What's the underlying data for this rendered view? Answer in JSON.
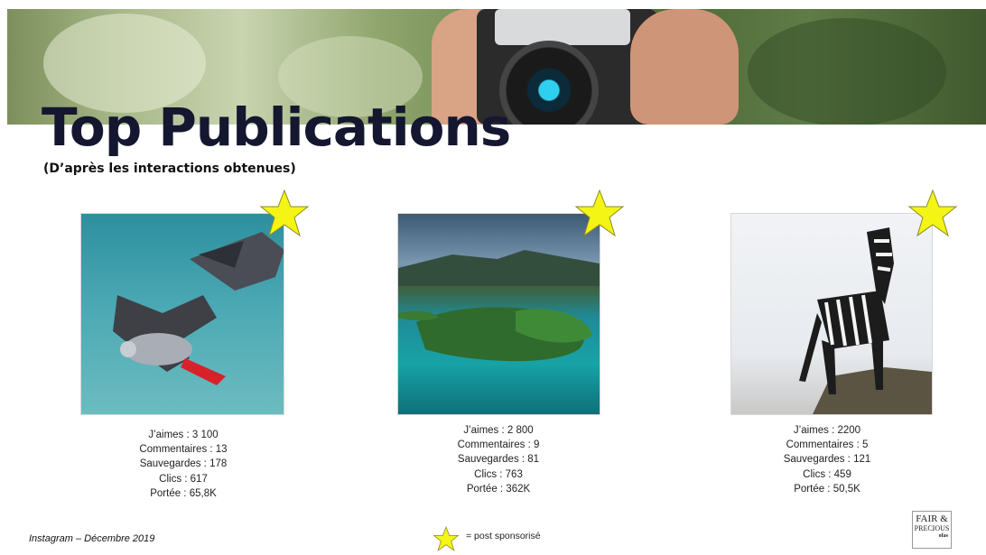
{
  "header": {
    "title": "Top Publications",
    "subtitle": "(D’après les interactions obtenues)"
  },
  "posts": [
    {
      "image": "grey-parrots-flying",
      "sponsored": true,
      "stats": [
        "J’aimes : 3 100",
        "Commentaires : 13",
        "Sauvegardes : 178",
        "Clics : 617",
        "Portée : 65,8K"
      ]
    },
    {
      "image": "lake-island-aerial",
      "sponsored": true,
      "stats": [
        "J’aimes : 2 800",
        "Commentaires : 9",
        "Sauvegardes : 81",
        "Clics : 763",
        "Portée : 362K"
      ]
    },
    {
      "image": "zebra-on-hill",
      "sponsored": true,
      "stats": [
        "J’aimes : 2200",
        "Commentaires : 5",
        "Sauvegardes : 121",
        "Clics : 459",
        "Portée : 50,5K"
      ]
    }
  ],
  "footer": {
    "source": "Instagram – Décembre 2019",
    "legend_text": "= post sponsorisé",
    "logo": {
      "line1": "FAIR &",
      "line2": "PRECIOUS",
      "line3": "ofas"
    }
  },
  "colors": {
    "star_fill": "#f4f514",
    "star_stroke": "#8a8a2a",
    "title": "#14172f"
  }
}
